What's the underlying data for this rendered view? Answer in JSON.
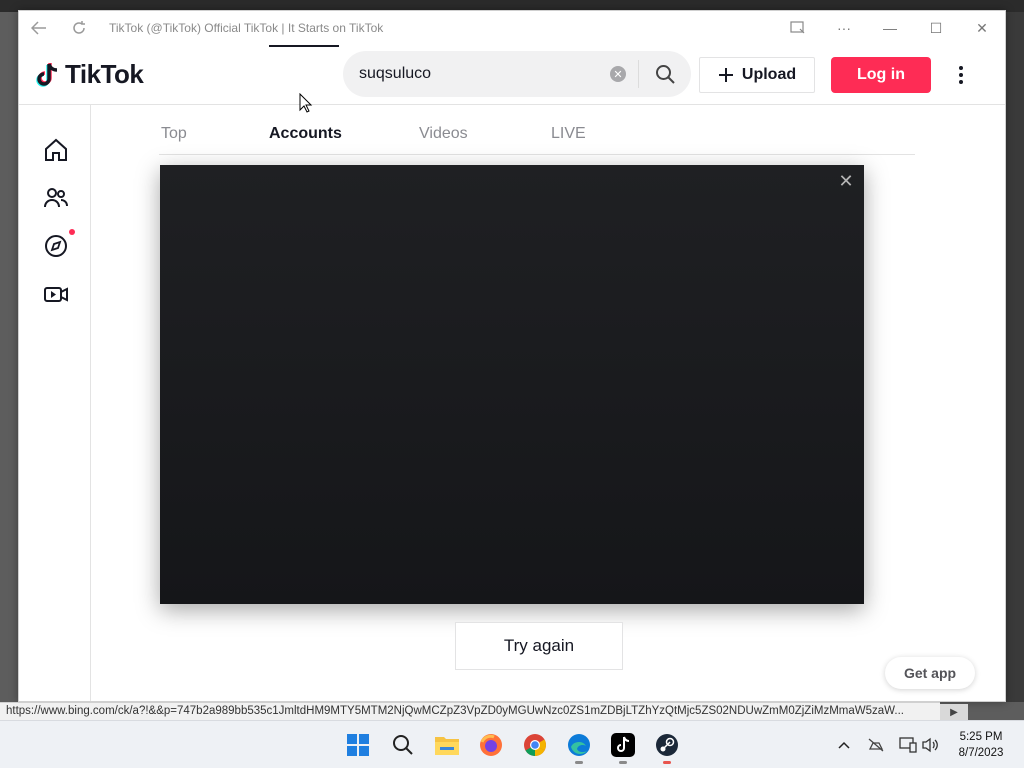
{
  "browser": {
    "title": "TikTok (@TikTok) Official TikTok | It Starts on TikTok",
    "status_url": "https://www.bing.com/ck/a?!&&p=747b2a989bb535c1JmltdHM9MTY5MTM2NjQwMCZpZ3VpZD0yMGUwNzc0ZS1mZDBjLTZhYzQtMjc5ZS02NDUwZmM0ZjZiMzMmaW5zaW..."
  },
  "header": {
    "logo_text": "TikTok",
    "search_value": "suqsuluco",
    "upload_label": "Upload",
    "login_label": "Log in"
  },
  "tabs": [
    {
      "label": "Top",
      "active": false
    },
    {
      "label": "Accounts",
      "active": true
    },
    {
      "label": "Videos",
      "active": false
    },
    {
      "label": "LIVE",
      "active": false
    }
  ],
  "main": {
    "try_again_label": "Try again",
    "get_app_label": "Get app"
  },
  "taskbar": {
    "time": "5:25 PM",
    "date": "8/7/2023"
  },
  "colors": {
    "accent": "#fe2c55",
    "modal_bg": "#1b1c1f"
  }
}
